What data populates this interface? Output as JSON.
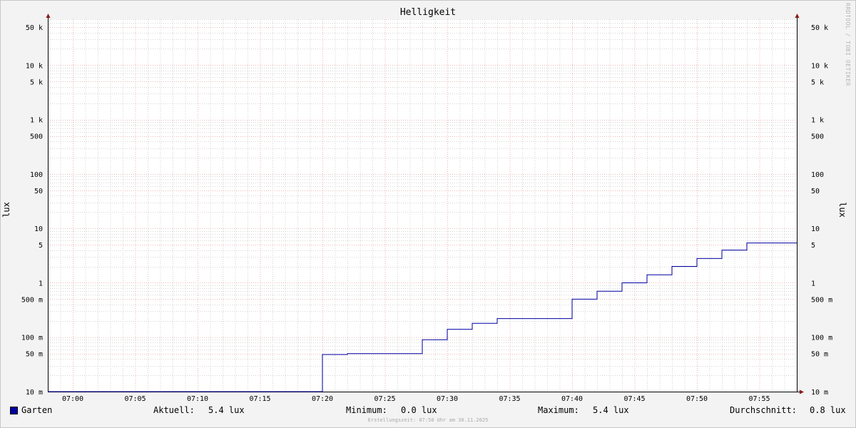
{
  "chart_data": {
    "type": "line",
    "title": "Helligkeit",
    "ylabel": "lux",
    "y_scale": "log",
    "ylim": [
      0.01,
      70000
    ],
    "y_ticks": [
      {
        "value": 0.01,
        "label": "10 m"
      },
      {
        "value": 0.05,
        "label": "50 m"
      },
      {
        "value": 0.1,
        "label": "100 m"
      },
      {
        "value": 0.5,
        "label": "500 m"
      },
      {
        "value": 1,
        "label": "1"
      },
      {
        "value": 5,
        "label": "5"
      },
      {
        "value": 10,
        "label": "10"
      },
      {
        "value": 50,
        "label": "50"
      },
      {
        "value": 100,
        "label": "100"
      },
      {
        "value": 500,
        "label": "500"
      },
      {
        "value": 1000,
        "label": "1 k"
      },
      {
        "value": 5000,
        "label": "5 k"
      },
      {
        "value": 10000,
        "label": "10 k"
      },
      {
        "value": 50000,
        "label": "50 k"
      }
    ],
    "x_ticks": [
      "07:00",
      "07:05",
      "07:10",
      "07:15",
      "07:20",
      "07:25",
      "07:30",
      "07:35",
      "07:40",
      "07:45",
      "07:50",
      "07:55"
    ],
    "xlim": [
      "06:58",
      "07:58"
    ],
    "grid": true,
    "series": [
      {
        "name": "Garten",
        "color": "#0000a0",
        "points": [
          [
            "06:58",
            0.01
          ],
          [
            "07:20",
            0.01
          ],
          [
            "07:20",
            0.048
          ],
          [
            "07:22",
            0.048
          ],
          [
            "07:22",
            0.05
          ],
          [
            "07:28",
            0.05
          ],
          [
            "07:28",
            0.09
          ],
          [
            "07:30",
            0.09
          ],
          [
            "07:30",
            0.14
          ],
          [
            "07:32",
            0.14
          ],
          [
            "07:32",
            0.18
          ],
          [
            "07:34",
            0.18
          ],
          [
            "07:34",
            0.22
          ],
          [
            "07:40",
            0.22
          ],
          [
            "07:40",
            0.5
          ],
          [
            "07:42",
            0.5
          ],
          [
            "07:42",
            0.7
          ],
          [
            "07:44",
            0.7
          ],
          [
            "07:44",
            1.0
          ],
          [
            "07:46",
            1.0
          ],
          [
            "07:46",
            1.4
          ],
          [
            "07:48",
            1.4
          ],
          [
            "07:48",
            2.0
          ],
          [
            "07:50",
            2.0
          ],
          [
            "07:50",
            2.8
          ],
          [
            "07:52",
            2.8
          ],
          [
            "07:52",
            4.0
          ],
          [
            "07:54",
            4.0
          ],
          [
            "07:54",
            5.4
          ],
          [
            "07:58",
            5.4
          ]
        ]
      }
    ]
  },
  "legend": {
    "series_name": "Garten",
    "current_label": "Aktuell:",
    "current_value": "5.4 lux",
    "min_label": "Minimum:",
    "min_value": "0.0 lux",
    "max_label": "Maximum:",
    "max_value": "5.4 lux",
    "avg_label": "Durchschnitt:",
    "avg_value": "0.8 lux"
  },
  "watermark": "RRDTOOL / TOBI OETIKER",
  "footer": "Erstellungszeit: 07:58 Uhr am 30.11.2025",
  "colors": {
    "line": "#0000a0",
    "major_grid": "#e8a0a0",
    "minor_grid": "#c8c8c8",
    "arrow": "#8b1a1a"
  }
}
